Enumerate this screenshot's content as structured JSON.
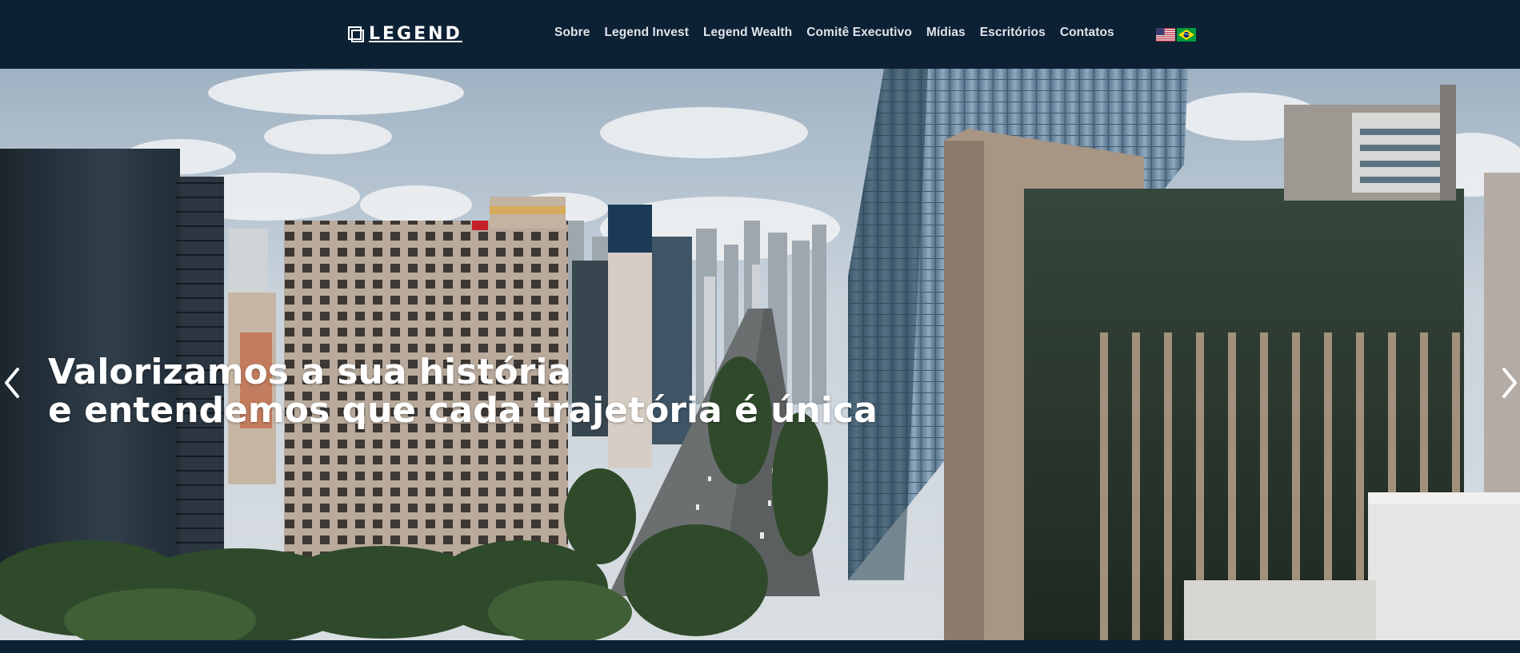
{
  "brand": {
    "name": "LEGEND"
  },
  "nav": {
    "items": [
      {
        "label": "Sobre"
      },
      {
        "label": "Legend Invest"
      },
      {
        "label": "Legend Wealth"
      },
      {
        "label": "Comitê Executivo"
      },
      {
        "label": "Mídias"
      },
      {
        "label": "Escritórios"
      },
      {
        "label": "Contatos"
      }
    ]
  },
  "languages": [
    {
      "icon": "us-flag-icon"
    },
    {
      "icon": "brazil-flag-icon"
    }
  ],
  "hero": {
    "heading_line1": "Valorizamos a sua história",
    "heading_line2": "e entendemos que cada trajetória é única",
    "prev_icon": "chevron-left-icon",
    "next_icon": "chevron-right-icon"
  },
  "colors": {
    "header_bg": "#0d2135",
    "nav_text": "#dfe4ea",
    "heading_text": "#ffffff"
  }
}
